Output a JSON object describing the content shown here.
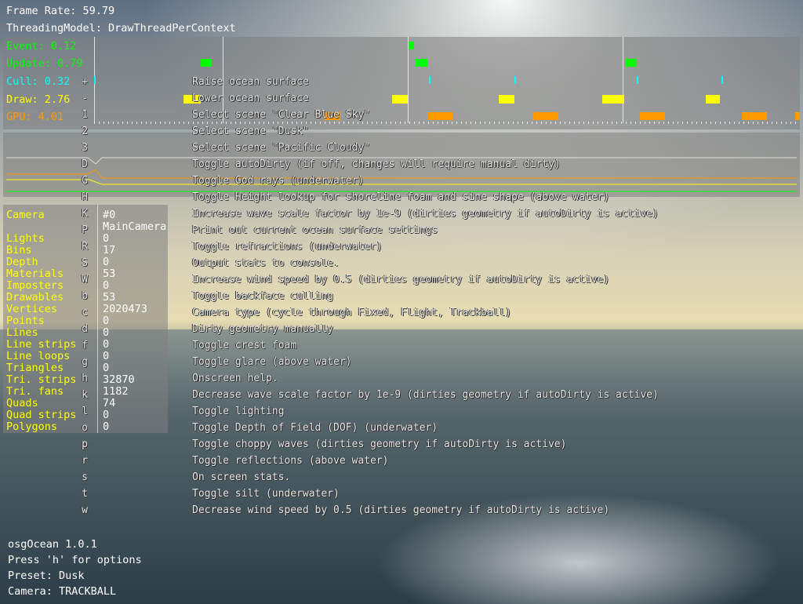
{
  "colors": {
    "event": "#00ff00",
    "update": "#00ff00",
    "cull": "#00ffff",
    "draw": "#ffff00",
    "gpu": "#ff9900",
    "label_yellow": "#ffff00"
  },
  "hud": {
    "frame_rate": "Frame Rate: 59.79",
    "threading": "ThreadingModel: DrawThreadPerContext"
  },
  "timings": [
    {
      "label": "Event: 0.12"
    },
    {
      "label": "Update: 0.79"
    },
    {
      "label": "Cull: 0.32"
    },
    {
      "label": "Draw: 2.76"
    },
    {
      "label": "GPU: 4.01"
    }
  ],
  "camera_stats": {
    "header_label": "Camera",
    "header_value": "#0",
    "camera_name": "MainCamera",
    "rows": [
      {
        "label": "Lights",
        "value": "0"
      },
      {
        "label": "Bins",
        "value": "17"
      },
      {
        "label": "Depth",
        "value": "0"
      },
      {
        "label": "Materials",
        "value": "53"
      },
      {
        "label": "Imposters",
        "value": "0"
      },
      {
        "label": "Drawables",
        "value": "53"
      },
      {
        "label": "Vertices",
        "value": "2020473"
      },
      {
        "label": "Points",
        "value": "0"
      },
      {
        "label": "Lines",
        "value": "0"
      },
      {
        "label": "Line strips",
        "value": "0"
      },
      {
        "label": "Line loops",
        "value": "0"
      },
      {
        "label": "Triangles",
        "value": "0"
      },
      {
        "label": "Tri. strips",
        "value": "32870"
      },
      {
        "label": "Tri. fans",
        "value": "1182"
      },
      {
        "label": "Quads",
        "value": "74"
      },
      {
        "label": "Quad strips",
        "value": "0"
      },
      {
        "label": "Polygons",
        "value": "0"
      }
    ]
  },
  "help": [
    {
      "key": "+",
      "desc": "Raise ocean surface"
    },
    {
      "key": "-",
      "desc": "Lower ocean surface"
    },
    {
      "key": "1",
      "desc": "Select scene \"Clear Blue Sky\""
    },
    {
      "key": "2",
      "desc": "Select scene \"Dusk\""
    },
    {
      "key": "3",
      "desc": "Select scene \"Pacific Cloudy\""
    },
    {
      "key": "D",
      "desc": "Toggle autoDirty (if off, changes will require manual dirty)"
    },
    {
      "key": "G",
      "desc": "Toggle God rays (underwater)"
    },
    {
      "key": "H",
      "desc": "Toggle Height lookup for shoreline foam and sine shape (above water)"
    },
    {
      "key": "K",
      "desc": "Increase wave scale factor by 1e-9 (dirties geometry if autoDirty is active)"
    },
    {
      "key": "P",
      "desc": "Print out current ocean surface settings"
    },
    {
      "key": "R",
      "desc": "Toggle refractions (underwater)"
    },
    {
      "key": "S",
      "desc": "Output stats to console."
    },
    {
      "key": "W",
      "desc": "Increase wind speed by 0.5 (dirties geometry if autoDirty is active)"
    },
    {
      "key": "b",
      "desc": "Toggle backface culling"
    },
    {
      "key": "c",
      "desc": "Camera type (cycle through Fixed, Flight, Trackball)"
    },
    {
      "key": "d",
      "desc": "Dirty geometry manually"
    },
    {
      "key": "f",
      "desc": "Toggle crest foam"
    },
    {
      "key": "g",
      "desc": "Toggle glare (above water)"
    },
    {
      "key": "h",
      "desc": "Onscreen help."
    },
    {
      "key": "k",
      "desc": "Decrease wave scale factor by 1e-9 (dirties geometry if autoDirty is active)"
    },
    {
      "key": "l",
      "desc": "Toggle lighting"
    },
    {
      "key": "o",
      "desc": "Toggle Depth of Field (DOF) (underwater)"
    },
    {
      "key": "p",
      "desc": "Toggle choppy waves (dirties geometry if autoDirty is active)"
    },
    {
      "key": "r",
      "desc": "Toggle reflections (above water)"
    },
    {
      "key": "s",
      "desc": "On screen stats."
    },
    {
      "key": "t",
      "desc": "Toggle silt (underwater)"
    },
    {
      "key": "w",
      "desc": "Decrease wind speed by 0.5 (dirties geometry if autoDirty is active)"
    }
  ],
  "footer": {
    "line1": "osgOcean 1.0.1",
    "line2": "Press 'h' for options",
    "line3": "Preset: Dusk",
    "line4": "Camera: TRACKBALL"
  }
}
